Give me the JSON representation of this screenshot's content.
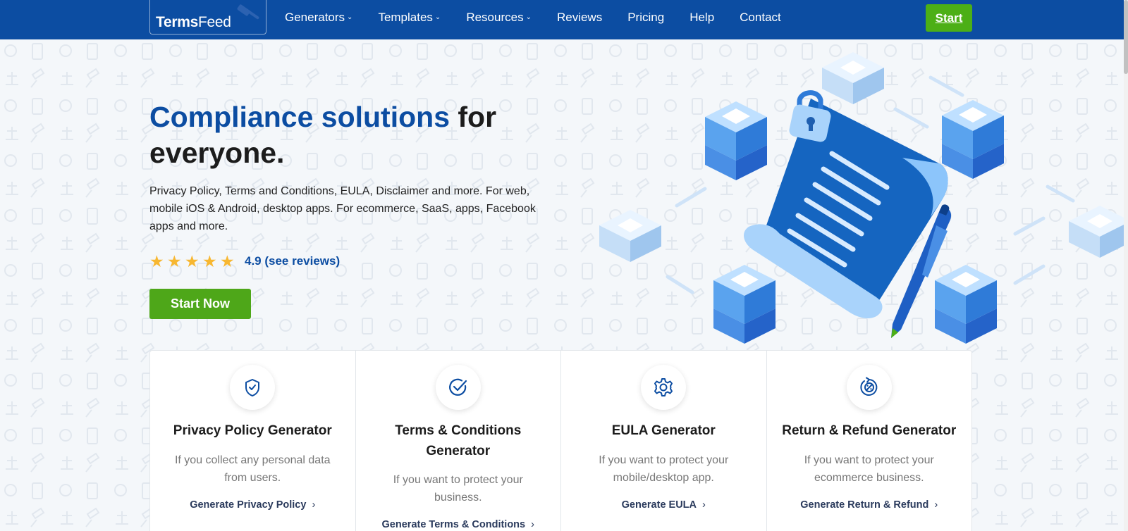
{
  "brand": {
    "name_bold": "Terms",
    "name_light": "Feed"
  },
  "nav": {
    "items": [
      {
        "label": "Generators",
        "dropdown": true
      },
      {
        "label": "Templates",
        "dropdown": true
      },
      {
        "label": "Resources",
        "dropdown": true
      },
      {
        "label": "Reviews",
        "dropdown": false
      },
      {
        "label": "Pricing",
        "dropdown": false
      },
      {
        "label": "Help",
        "dropdown": false
      },
      {
        "label": "Contact",
        "dropdown": false
      }
    ],
    "start_label": "Start"
  },
  "hero": {
    "title_accent": "Compliance solutions",
    "title_rest": " for everyone.",
    "description": "Privacy Policy, Terms and Conditions, EULA, Disclaimer and more. For web, mobile iOS & Android, desktop apps. For ecommerce, SaaS, apps, Facebook apps and more.",
    "rating_stars": 5,
    "rating_text": "4.9 (see reviews)",
    "cta_label": "Start Now"
  },
  "cards": [
    {
      "icon": "shield-check-icon",
      "title": "Privacy Policy Generator",
      "description": "If you collect any personal data from users.",
      "link": "Generate Privacy Policy"
    },
    {
      "icon": "check-circle-icon",
      "title": "Terms & Conditions Generator",
      "description": "If you want to protect your business.",
      "link": "Generate Terms & Conditions"
    },
    {
      "icon": "gear-icon",
      "title": "EULA Generator",
      "description": "If you want to protect your mobile/desktop app.",
      "link": "Generate EULA"
    },
    {
      "icon": "refund-icon",
      "title": "Return & Refund Generator",
      "description": "If you want to protect your ecommerce business.",
      "link": "Generate Return & Refund"
    }
  ],
  "colors": {
    "nav_bg": "#0c4da2",
    "accent": "#0c4da2",
    "cta_green": "#4ea719",
    "star": "#f7b731"
  }
}
